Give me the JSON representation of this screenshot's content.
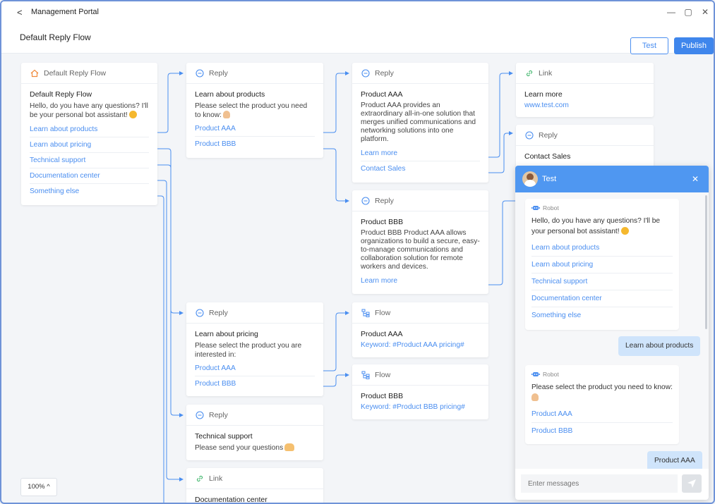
{
  "window": {
    "title": "Management Portal",
    "back_glyph": "<",
    "minimize_glyph": "—",
    "maximize_glyph": "▢",
    "close_glyph": "✕"
  },
  "toolbar": {
    "page_title": "Default Reply Flow",
    "test_label": "Test",
    "publish_label": "Publish"
  },
  "colors": {
    "accent": "#3f86ec",
    "link": "#4a8ef0",
    "chat_header": "#4f97f1",
    "user_bubble": "#cfe4fb"
  },
  "nodes": {
    "root": {
      "type": "Default Reply Flow",
      "icon": "home-icon",
      "title": "Default Reply Flow",
      "desc": "Hello, do you have any questions? I'll be your personal bot assistant!",
      "options": [
        "Learn about products",
        "Learn about pricing",
        "Technical support",
        "Documentation center",
        "Something else"
      ]
    },
    "reply_products": {
      "type": "Reply",
      "icon": "reply-icon",
      "title": "Learn about products",
      "desc": "Please select the product you need to know:",
      "options": [
        "Product AAA",
        "Product BBB"
      ]
    },
    "reply_aaa": {
      "type": "Reply",
      "icon": "reply-icon",
      "title": "Product AAA",
      "desc": "Product AAA provides an extraordinary all-in-one solution that merges unified communications and networking solutions into one platform.",
      "options": [
        "Learn more",
        "Contact Sales"
      ]
    },
    "link_learn_more": {
      "type": "Link",
      "icon": "link-icon",
      "title": "Learn more",
      "url": "www.test.com"
    },
    "reply_contact": {
      "type": "Reply",
      "icon": "reply-icon",
      "title": "Contact Sales"
    },
    "reply_bbb": {
      "type": "Reply",
      "icon": "reply-icon",
      "title": "Product BBB",
      "desc": "Product BBB Product AAA allows organizations to build a secure, easy-to-manage communications and collaboration solution for remote workers and devices.",
      "options": [
        "Learn more"
      ]
    },
    "reply_pricing": {
      "type": "Reply",
      "icon": "reply-icon",
      "title": "Learn about pricing",
      "desc": "Please select the product you are interested in:",
      "options": [
        "Product AAA",
        "Product BBB"
      ]
    },
    "flow_aaa": {
      "type": "Flow",
      "icon": "flow-icon",
      "title": "Product AAA",
      "keyword": "Keyword: #Product AAA pricing#"
    },
    "flow_bbb": {
      "type": "Flow",
      "icon": "flow-icon",
      "title": "Product BBB",
      "keyword": "Keyword: #Product BBB pricing#"
    },
    "reply_support": {
      "type": "Reply",
      "icon": "reply-icon",
      "title": "Technical support",
      "desc": "Please send your questions"
    },
    "link_docs": {
      "type": "Link",
      "icon": "link-icon",
      "title": "Documentation center"
    }
  },
  "zoom": {
    "label": "100%",
    "caret": "^"
  },
  "chat": {
    "title": "Test",
    "close_glyph": "✕",
    "bot_label": "Robot",
    "msg1": {
      "text": "Hello, do you have any questions? I'll be your personal bot assistant!",
      "options": [
        "Learn about products",
        "Learn about pricing",
        "Technical support",
        "Documentation center",
        "Something else"
      ]
    },
    "user1": "Learn about products",
    "msg2": {
      "text": "Please select the product you need to know:",
      "options": [
        "Product AAA",
        "Product BBB"
      ]
    },
    "user2": "Product AAA",
    "input_placeholder": "Enter messages"
  }
}
